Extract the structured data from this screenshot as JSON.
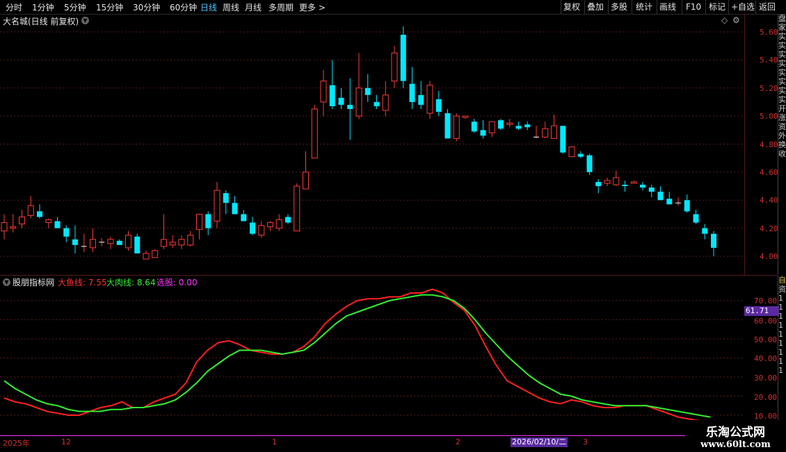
{
  "toolbar": {
    "periods": [
      "分时",
      "1分钟",
      "5分钟",
      "15分钟",
      "30分钟",
      "60分钟",
      "日线",
      "周线",
      "月线",
      "多周期",
      "更多 >"
    ],
    "active_index": 6,
    "actions": [
      "复权",
      "叠加",
      "多股",
      "统计",
      "画线",
      "F10",
      "标记",
      "+自选",
      "返回"
    ]
  },
  "main_panel": {
    "title": "大名城(日线 前复权)",
    "price_ticks": [
      "5.60",
      "5.40",
      "5.20",
      "5.00",
      "4.80",
      "4.60",
      "4.40",
      "4.20",
      "4.00"
    ]
  },
  "indicator_panel": {
    "title": "股朋指标网",
    "line1_label": "大鱼线: 7.55",
    "line2_label": "大肉线: 8.64",
    "line3_label": "选股: 0.00",
    "value_ticks": [
      "70.00",
      "60.00",
      "50.00",
      "40.00",
      "30.00",
      "20.00",
      "10.00"
    ],
    "highlight_value": "61.71"
  },
  "date_axis": {
    "labels": [
      "2025年",
      "12",
      "1",
      "2",
      "3"
    ],
    "cursor_date": "2026/02/10/二"
  },
  "watermark": {
    "line1": "乐淘公式网",
    "line2": "www.60lt.com"
  },
  "side_strip": {
    "top_chars": [
      "盘",
      "家",
      "实",
      "实",
      "实",
      "实",
      "实",
      "实",
      "实",
      "实",
      "开",
      "涨",
      "资",
      "外",
      "换",
      "收"
    ],
    "bottom_chars": [
      "自",
      "资",
      "1",
      "1",
      "1",
      "1",
      "1",
      "1",
      "1",
      "1",
      "1"
    ]
  },
  "colors": {
    "up": "#ff3b3b",
    "down": "#00e8ff",
    "line1": "#ff2020",
    "line2": "#33ee33",
    "line3": "#ff33ff",
    "grid": "#5a1a1a",
    "accent": "#4ec3ff",
    "highlight_bg": "#5a2aa0"
  },
  "chart_data": [
    {
      "type": "candlestick",
      "title": "大名城(日线 前复权)",
      "ylim": [
        4.0,
        5.6
      ],
      "fields": [
        "open",
        "high",
        "low",
        "close"
      ],
      "candles": [
        [
          4.18,
          4.3,
          4.12,
          4.24
        ],
        [
          4.2,
          4.3,
          4.17,
          4.21
        ],
        [
          4.23,
          4.33,
          4.2,
          4.28
        ],
        [
          4.29,
          4.43,
          4.27,
          4.36
        ],
        [
          4.32,
          4.37,
          4.27,
          4.28
        ],
        [
          4.24,
          4.27,
          4.2,
          4.26
        ],
        [
          4.25,
          4.28,
          4.2,
          4.2
        ],
        [
          4.2,
          4.22,
          4.1,
          4.14
        ],
        [
          4.12,
          4.22,
          4.02,
          4.08
        ],
        [
          4.07,
          4.16,
          4.03,
          4.07
        ],
        [
          4.06,
          4.2,
          4.03,
          4.12
        ],
        [
          4.1,
          4.13,
          4.07,
          4.1
        ],
        [
          4.09,
          4.14,
          4.05,
          4.12
        ],
        [
          4.11,
          4.12,
          4.08,
          4.08
        ],
        [
          4.06,
          4.18,
          4.04,
          4.15
        ],
        [
          4.14,
          4.16,
          4.02,
          4.02
        ],
        [
          3.98,
          4.04,
          3.98,
          4.02
        ],
        [
          3.99,
          4.05,
          3.99,
          4.04
        ],
        [
          4.07,
          4.3,
          4.05,
          4.12
        ],
        [
          4.08,
          4.15,
          4.06,
          4.1
        ],
        [
          4.08,
          4.15,
          4.05,
          4.12
        ],
        [
          4.08,
          4.18,
          4.07,
          4.15
        ],
        [
          4.19,
          4.22,
          4.12,
          4.3
        ],
        [
          4.3,
          4.32,
          4.15,
          4.2
        ],
        [
          4.25,
          4.53,
          4.2,
          4.47
        ],
        [
          4.45,
          4.47,
          4.3,
          4.38
        ],
        [
          4.38,
          4.43,
          4.3,
          4.3
        ],
        [
          4.3,
          4.33,
          4.25,
          4.25
        ],
        [
          4.24,
          4.28,
          4.15,
          4.16
        ],
        [
          4.15,
          4.25,
          4.13,
          4.22
        ],
        [
          4.21,
          4.25,
          4.18,
          4.24
        ],
        [
          4.2,
          4.3,
          4.18,
          4.26
        ],
        [
          4.28,
          4.3,
          4.23,
          4.24
        ],
        [
          4.18,
          4.52,
          4.18,
          4.5
        ],
        [
          4.48,
          4.75,
          4.48,
          4.6
        ],
        [
          4.7,
          5.08,
          4.7,
          5.05
        ],
        [
          5.1,
          5.33,
          5.0,
          5.25
        ],
        [
          5.22,
          5.4,
          5.05,
          5.07
        ],
        [
          5.13,
          5.2,
          5.05,
          5.08
        ],
        [
          5.08,
          5.27,
          4.83,
          5.05
        ],
        [
          5.0,
          5.45,
          4.98,
          5.2
        ],
        [
          5.2,
          5.3,
          5.1,
          5.15
        ],
        [
          5.1,
          5.15,
          5.05,
          5.07
        ],
        [
          5.04,
          5.25,
          5.0,
          5.15
        ],
        [
          5.25,
          5.5,
          5.2,
          5.45
        ],
        [
          5.58,
          5.64,
          5.2,
          5.25
        ],
        [
          5.23,
          5.35,
          5.05,
          5.1
        ],
        [
          5.15,
          5.25,
          5.05,
          5.08
        ],
        [
          5.02,
          5.25,
          4.98,
          5.22
        ],
        [
          5.12,
          5.18,
          5.0,
          5.03
        ],
        [
          5.02,
          5.05,
          4.84,
          4.84
        ],
        [
          4.84,
          5.02,
          4.82,
          5.0
        ],
        [
          4.99,
          5.0,
          4.98,
          5.0
        ],
        [
          4.96,
          4.98,
          4.88,
          4.89
        ],
        [
          4.9,
          4.97,
          4.84,
          4.86
        ],
        [
          4.88,
          4.96,
          4.85,
          4.96
        ],
        [
          4.97,
          4.98,
          4.9,
          4.91
        ],
        [
          4.94,
          4.98,
          4.92,
          4.95
        ],
        [
          4.93,
          4.96,
          4.9,
          4.91
        ],
        [
          4.94,
          4.96,
          4.9,
          4.92
        ],
        [
          4.85,
          4.93,
          4.84,
          4.85
        ],
        [
          4.85,
          4.96,
          4.84,
          4.91
        ],
        [
          4.84,
          5.01,
          4.84,
          4.93
        ],
        [
          4.93,
          4.93,
          4.73,
          4.74
        ],
        [
          4.71,
          4.78,
          4.71,
          4.78
        ],
        [
          4.73,
          4.75,
          4.7,
          4.71
        ],
        [
          4.72,
          4.73,
          4.58,
          4.6
        ],
        [
          4.53,
          4.55,
          4.45,
          4.5
        ],
        [
          4.52,
          4.56,
          4.5,
          4.54
        ],
        [
          4.51,
          4.61,
          4.5,
          4.56
        ],
        [
          4.51,
          4.54,
          4.46,
          4.5
        ],
        [
          4.52,
          4.54,
          4.52,
          4.53
        ],
        [
          4.51,
          4.53,
          4.47,
          4.49
        ],
        [
          4.49,
          4.51,
          4.42,
          4.46
        ],
        [
          4.46,
          4.5,
          4.42,
          4.4
        ],
        [
          4.41,
          4.46,
          4.38,
          4.37
        ],
        [
          4.38,
          4.42,
          4.36,
          4.38
        ],
        [
          4.4,
          4.44,
          4.31,
          4.32
        ],
        [
          4.3,
          4.33,
          4.23,
          4.24
        ],
        [
          4.2,
          4.23,
          4.12,
          4.16
        ],
        [
          4.16,
          4.18,
          4.0,
          4.06
        ]
      ],
      "up_color": "#ff3b3b",
      "down_color": "#00e8ff",
      "grid": true
    },
    {
      "type": "line",
      "title": "股朋指标网",
      "ylim": [
        0,
        80
      ],
      "series": [
        {
          "name": "大鱼线",
          "color": "#ff2020",
          "values": [
            19,
            17,
            16,
            14,
            12,
            11,
            10,
            10,
            12,
            14,
            15,
            17,
            14,
            14,
            17,
            19,
            21,
            27,
            38,
            44,
            48,
            49,
            47,
            44,
            43,
            42,
            42,
            43,
            46,
            51,
            58,
            63,
            67,
            70,
            71,
            71,
            72,
            72,
            74,
            74,
            76,
            74,
            69,
            65,
            57,
            46,
            36,
            28,
            25,
            22,
            19,
            17,
            16,
            18,
            17,
            15,
            14,
            14,
            15,
            15,
            15,
            13,
            11,
            9,
            8,
            7
          ]
        },
        {
          "name": "大肉线",
          "color": "#33ee33",
          "values": [
            28,
            24,
            21,
            18,
            16,
            15,
            13,
            12,
            12,
            12,
            13,
            13,
            14,
            14,
            15,
            16,
            18,
            22,
            27,
            33,
            37,
            41,
            44,
            44,
            44,
            43,
            42,
            43,
            44,
            48,
            53,
            58,
            62,
            64,
            66,
            68,
            70,
            71,
            72,
            73,
            73,
            72,
            70,
            66,
            60,
            53,
            47,
            41,
            36,
            31,
            27,
            24,
            21,
            20,
            18,
            17,
            16,
            15,
            15,
            15,
            15,
            14,
            13,
            12,
            11,
            10,
            9
          ]
        },
        {
          "name": "选股",
          "color": "#ff33ff",
          "values": [
            0
          ]
        }
      ]
    }
  ]
}
